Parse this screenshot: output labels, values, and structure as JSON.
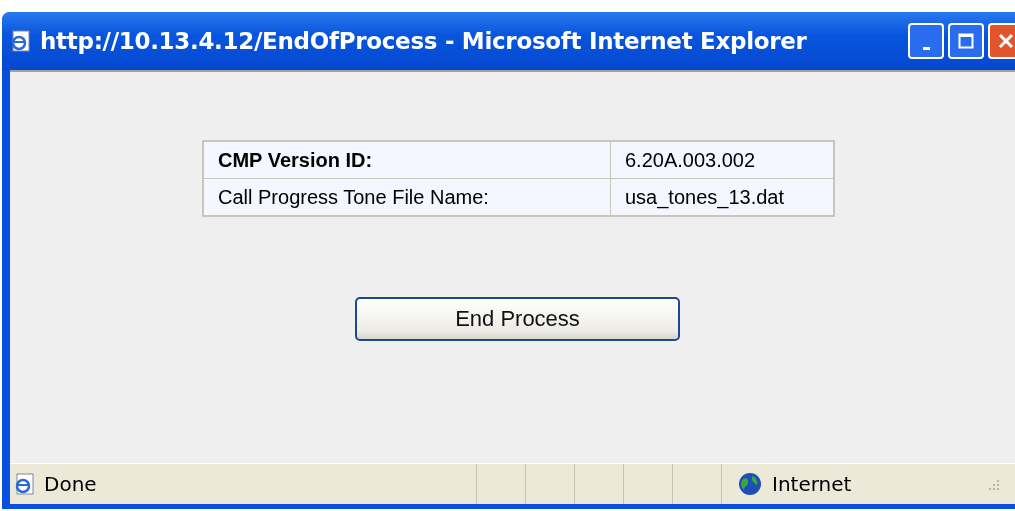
{
  "window": {
    "title": "http://10.13.4.12/EndOfProcess - Microsoft Internet Explorer"
  },
  "table": {
    "rows": [
      {
        "label": "CMP Version ID:",
        "value": "6.20A.003.002",
        "kind": "header"
      },
      {
        "label": "Call Progress Tone File Name:",
        "value": "usa_tones_13.dat",
        "kind": "normal"
      }
    ]
  },
  "button": {
    "label": "End Process"
  },
  "status_bar": {
    "status": "Done",
    "zone": "Internet"
  }
}
